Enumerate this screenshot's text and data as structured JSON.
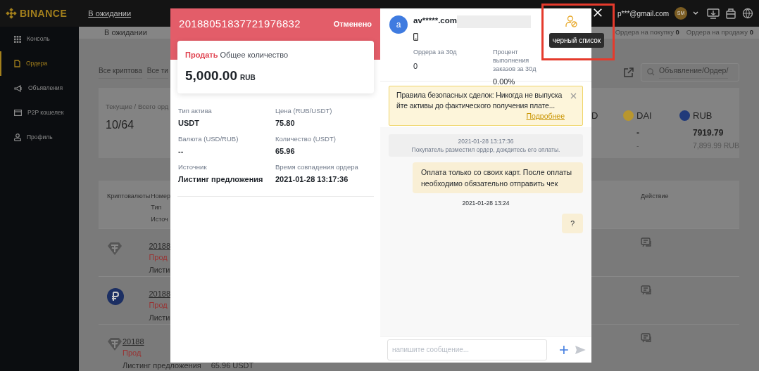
{
  "top_nav": {
    "logo": "BINANCE",
    "link": "В ожидании",
    "email": "p***@gmail.com",
    "avatar": "SM"
  },
  "sidebar": {
    "items": [
      {
        "label": "Консоль",
        "selected": false
      },
      {
        "label": "Ордера",
        "selected": true
      },
      {
        "label": "Объявления",
        "selected": false
      },
      {
        "label": "P2P кошелек",
        "selected": false
      },
      {
        "label": "Профиль",
        "selected": false
      }
    ]
  },
  "subheader": {
    "tab": "В ожидании",
    "counters": [
      {
        "label": "Ордера на покупку",
        "count": "0"
      },
      {
        "label": "Ордера на продажу",
        "count": "0"
      }
    ]
  },
  "filters": [
    "Все криптова",
    "Все ти"
  ],
  "search": {
    "placeholder": "Объявление/Ордер/"
  },
  "summary": {
    "label": "Текущие / Всего орд",
    "value": "10/64",
    "assets": [
      {
        "symbol": "D"
      },
      {
        "symbol": "DAI",
        "color": "#b8962e",
        "amount": "-",
        "converted": "-"
      },
      {
        "symbol": "RUB",
        "color": "#213a7a",
        "amount": "7919.79",
        "converted": "7,899.99 RUB"
      }
    ]
  },
  "orders_table": {
    "header": {
      "crypto": "Криптовалюты",
      "number_lines": [
        "Номер",
        "Тип",
        "Источ"
      ],
      "action": "Действие"
    },
    "rows": [
      {
        "kind": "tether",
        "number": "20188",
        "side": "Прод",
        "source": "Листи"
      },
      {
        "kind": "ruble",
        "number": "20188",
        "side": "Прод",
        "source": "Листи"
      },
      {
        "kind": "tether",
        "number": "20188",
        "side": "Прод",
        "source": "Листинг предложения",
        "amount": "65.96 USDT"
      }
    ]
  },
  "order_modal": {
    "order_id": "20188051837721976832",
    "status": "Отменено",
    "side": "Продать",
    "total_label": "Общее количество",
    "amount": "5,000.00",
    "currency": "RUB",
    "details": [
      {
        "label": "Тип актива",
        "value": "USDT"
      },
      {
        "label": "Цена (RUB/USDT)",
        "value": "75.80"
      },
      {
        "label": "Валюта (USD/RUB)",
        "value": "--"
      },
      {
        "label": "Количество (USDT)",
        "value": "65.96"
      },
      {
        "label": "Источник",
        "value": "Листинг предложения"
      },
      {
        "label": "Время совпадения ордера",
        "value": "2021-01-28 13:17:36"
      }
    ],
    "counterparty": {
      "initial": "a",
      "name": "av*****.com",
      "stats": [
        {
          "label": "Ордера за 30д",
          "value": "0"
        },
        {
          "label": "Процент выполнения заказов за 30д",
          "value": "0.00%"
        }
      ]
    },
    "blacklist_tooltip": "черный список",
    "notice": {
      "text": "Правила безопасных сделок: Никогда не выпускайте активы до фактического получения плате...",
      "link": "Подробнее"
    },
    "messages": [
      {
        "kind": "system",
        "time": "2021-01-28 13:17:36",
        "text": "Покупатель разместил ордер, дождитесь его оплаты."
      },
      {
        "kind": "outgoing",
        "text": "Оплата только со своих карт. После оплаты необходимо обязательно отправить чек"
      },
      {
        "kind": "time",
        "text": "2021-01-28 13:24"
      },
      {
        "kind": "outgoing",
        "text": "?"
      }
    ],
    "composer": {
      "placeholder": "напишите сообщение..."
    }
  }
}
